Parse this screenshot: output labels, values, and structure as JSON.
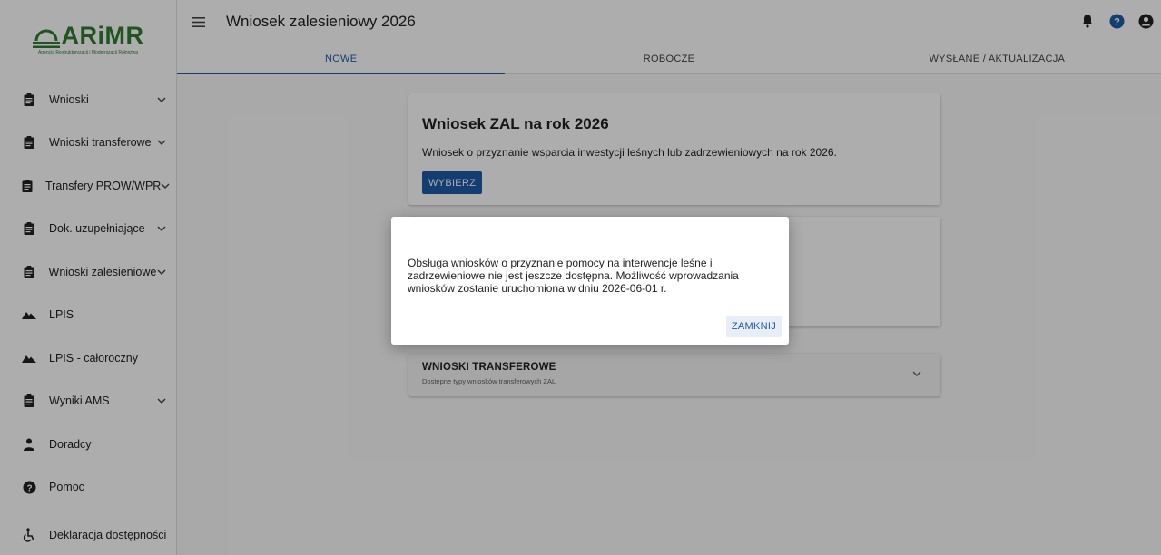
{
  "app": {
    "logo_text": "ARiMR",
    "logo_subtitle": "Agencja Restrukturyzacji i Modernizacji Rolnictwa",
    "brand_color": "#2e7d32",
    "accent_color": "#1e5aa8"
  },
  "header": {
    "title": "Wniosek zalesieniowy 2026",
    "icons": [
      "bell-icon",
      "help-icon",
      "account-icon"
    ]
  },
  "tabs": [
    {
      "label": "NOWE",
      "active": true
    },
    {
      "label": "ROBOCZE",
      "active": false
    },
    {
      "label": "WYSŁANE / AKTUALIZACJA",
      "active": false
    }
  ],
  "sidebar": {
    "items": [
      {
        "label": "Wnioski",
        "icon": "clipboard-icon",
        "expandable": true
      },
      {
        "label": "Wnioski transferowe",
        "icon": "clipboard-icon",
        "expandable": true
      },
      {
        "label": "Transfery PROW/WPR",
        "icon": "clipboard-icon",
        "expandable": true
      },
      {
        "label": "Dok. uzupełniające",
        "icon": "clipboard-icon",
        "expandable": true
      },
      {
        "label": "Wnioski zalesieniowe",
        "icon": "clipboard-icon",
        "expandable": true
      },
      {
        "label": "LPIS",
        "icon": "terrain-icon",
        "expandable": false
      },
      {
        "label": "LPIS - całoroczny",
        "icon": "terrain-icon",
        "expandable": false
      },
      {
        "label": "Wyniki AMS",
        "icon": "clipboard-icon",
        "expandable": true
      },
      {
        "label": "Doradcy",
        "icon": "person-icon",
        "expandable": false
      },
      {
        "label": "Pomoc",
        "icon": "help-icon",
        "expandable": false
      }
    ],
    "footer_item": {
      "label": "Deklaracja dostępności",
      "icon": "accessibility-icon"
    }
  },
  "main": {
    "card1": {
      "title": "Wniosek ZAL na rok 2026",
      "description": "Wniosek o przyznanie wsparcia inwestycji leśnych lub zadrzewieniowych na rok 2026.",
      "button_label": "WYBIERZ"
    },
    "transfer_panel": {
      "title": "WNIOSKI TRANSFEROWE",
      "subtitle": "Dostępne typy wniosków transferowych ZAL"
    }
  },
  "dialog": {
    "message": "Obsługa wniosków o przyznanie pomocy na interwencje leśne i zadrzewieniowe nie jest jeszcze dostępna. Możliwość wprowadzania wniosków zostanie uruchomiona w dniu 2026-06-01 r.",
    "button_label": "ZAMKNIJ"
  }
}
